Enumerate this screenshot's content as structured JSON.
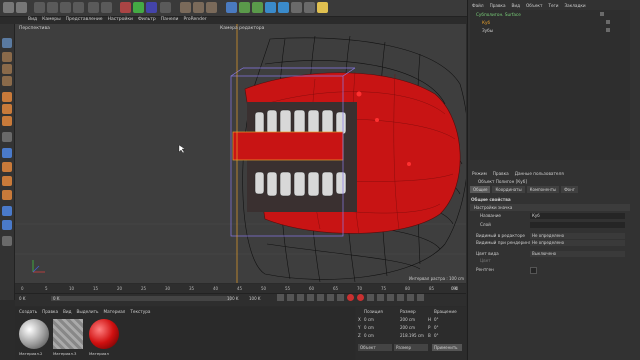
{
  "menu": [
    "Вид",
    "Камеры",
    "Представление",
    "Настройки",
    "Фильтр",
    "Панели",
    "ProRender"
  ],
  "viewport": {
    "label_left": "Перспектива",
    "label_center": "Камера редактора",
    "status": "Интервал растра : 100 cm"
  },
  "object_manager": {
    "tabs": [
      "Файл",
      "Правка",
      "Вид",
      "Объект",
      "Теги",
      "Закладки"
    ],
    "items": [
      "Субполигон. Surface",
      "Куб",
      "Зубы"
    ]
  },
  "attribute_manager": {
    "menu": [
      "Режим",
      "Правка",
      "Данные пользователя"
    ],
    "object_title": "Объект Полигон [Куб]",
    "tabs": [
      "Общие",
      "Координаты",
      "Компоненты",
      "Фонг"
    ],
    "section": "Общие свойства",
    "subsection": "Настройки значка",
    "rows": [
      {
        "label": "Название",
        "value": "Куб"
      },
      {
        "label": "Слой",
        "value": ""
      },
      {
        "label": "Видимый в редакторе",
        "value": "Не определено"
      },
      {
        "label": "Видимый при рендеринге",
        "value": "Не определено"
      },
      {
        "label": "Цвет вида",
        "value": "Выключено"
      },
      {
        "label": "Цвет",
        "value": ""
      },
      {
        "label": "Рентген",
        "value": ""
      }
    ]
  },
  "timeline": {
    "ticks": [
      "0",
      "5",
      "10",
      "15",
      "20",
      "25",
      "30",
      "35",
      "40",
      "45",
      "50",
      "55",
      "60",
      "65",
      "70",
      "75",
      "80",
      "85",
      "90"
    ],
    "frame_start": "0 K",
    "frame_current": "0 K",
    "frame_end": "100 K",
    "frame_max": "100 K",
    "frame_right": "0 K"
  },
  "materials": {
    "menu": [
      "Создать",
      "Правка",
      "Вид",
      "Выделить",
      "Материал",
      "Текстура"
    ],
    "items": [
      "Материал.2",
      "Материал.3",
      "Материал"
    ]
  },
  "coords": {
    "headers": [
      "Позиция",
      "Размер",
      "Вращение"
    ],
    "rows": [
      {
        "axis": "X",
        "pos": "0 cm",
        "size": "200 cm",
        "rot_axis": "H",
        "rot": "0°"
      },
      {
        "axis": "Y",
        "pos": "0 cm",
        "size": "200 cm",
        "rot_axis": "P",
        "rot": "0°"
      },
      {
        "axis": "Z",
        "pos": "0 cm",
        "size": "218.195 cm",
        "rot_axis": "B",
        "rot": "0°"
      }
    ],
    "mode1": "Объект",
    "mode2": "Размер",
    "apply": "Применить"
  },
  "colors": {
    "accent": "#e8a02a",
    "red": "#d11a1a",
    "ui_dark": "#2b2b2b"
  }
}
